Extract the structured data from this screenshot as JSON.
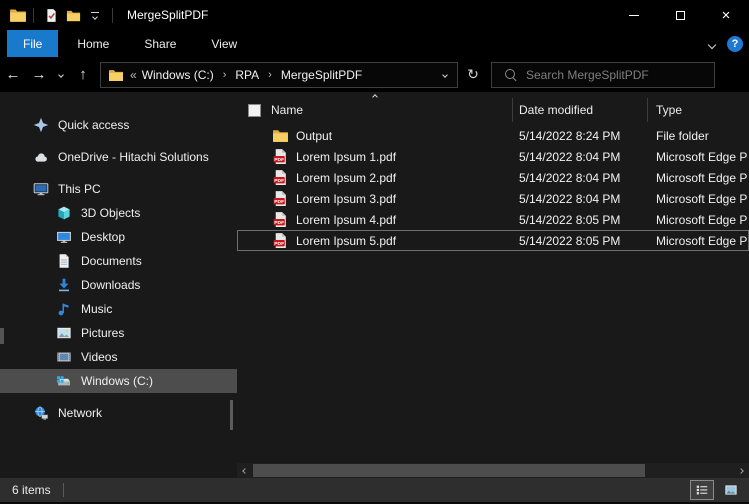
{
  "window": {
    "title": "MergeSplitPDF"
  },
  "ribbon": {
    "tabs": [
      {
        "label": "File",
        "active": true
      },
      {
        "label": "Home",
        "active": false
      },
      {
        "label": "Share",
        "active": false
      },
      {
        "label": "View",
        "active": false
      }
    ],
    "help_label": "?"
  },
  "address_bar": {
    "overflow_prefix": "«",
    "separator": "›",
    "segments": [
      "Windows (C:)",
      "RPA",
      "MergeSplitPDF"
    ]
  },
  "search": {
    "placeholder": "Search MergeSplitPDF"
  },
  "sidebar": {
    "items": [
      {
        "label": "Quick access",
        "icon": "quick-access-star-icon",
        "level": 0,
        "selected": false
      },
      {
        "label": "OneDrive - Hitachi Solutions",
        "icon": "onedrive-cloud-icon",
        "level": 0,
        "selected": false
      },
      {
        "label": "This PC",
        "icon": "this-pc-icon",
        "level": 0,
        "selected": false
      },
      {
        "label": "3D Objects",
        "icon": "3d-objects-icon",
        "level": 1,
        "selected": false
      },
      {
        "label": "Desktop",
        "icon": "desktop-icon",
        "level": 1,
        "selected": false
      },
      {
        "label": "Documents",
        "icon": "documents-icon",
        "level": 1,
        "selected": false
      },
      {
        "label": "Downloads",
        "icon": "downloads-icon",
        "level": 1,
        "selected": false
      },
      {
        "label": "Music",
        "icon": "music-icon",
        "level": 1,
        "selected": false
      },
      {
        "label": "Pictures",
        "icon": "pictures-icon",
        "level": 1,
        "selected": false
      },
      {
        "label": "Videos",
        "icon": "videos-icon",
        "level": 1,
        "selected": false
      },
      {
        "label": "Windows (C:)",
        "icon": "windows-drive-icon",
        "level": 1,
        "selected": true
      },
      {
        "label": "Network",
        "icon": "network-icon",
        "level": 0,
        "selected": false
      }
    ]
  },
  "file_list": {
    "columns": [
      {
        "label": "Name",
        "sort": "ascending"
      },
      {
        "label": "Date modified",
        "sort": null
      },
      {
        "label": "Type",
        "sort": null
      }
    ],
    "rows": [
      {
        "name": "Output",
        "icon": "folder-icon",
        "date_modified": "5/14/2022 8:24 PM",
        "type": "File folder",
        "focused": false
      },
      {
        "name": "Lorem Ipsum 1.pdf",
        "icon": "pdf-icon",
        "date_modified": "5/14/2022 8:04 PM",
        "type": "Microsoft Edge P",
        "focused": false
      },
      {
        "name": "Lorem Ipsum 2.pdf",
        "icon": "pdf-icon",
        "date_modified": "5/14/2022 8:04 PM",
        "type": "Microsoft Edge P",
        "focused": false
      },
      {
        "name": "Lorem Ipsum 3.pdf",
        "icon": "pdf-icon",
        "date_modified": "5/14/2022 8:04 PM",
        "type": "Microsoft Edge P",
        "focused": false
      },
      {
        "name": "Lorem Ipsum 4.pdf",
        "icon": "pdf-icon",
        "date_modified": "5/14/2022 8:05 PM",
        "type": "Microsoft Edge P",
        "focused": false
      },
      {
        "name": "Lorem Ipsum 5.pdf",
        "icon": "pdf-icon",
        "date_modified": "5/14/2022 8:05 PM",
        "type": "Microsoft Edge P",
        "focused": true
      }
    ]
  },
  "status_bar": {
    "items_count": "6 items"
  },
  "icons": {
    "search-icon": "magnifier",
    "refresh-icon": "↻",
    "back-icon": "←",
    "forward-icon": "→",
    "up-icon": "↑",
    "recent-locations-icon": "chevron-down",
    "ribbon-expand-icon": "chevron-down",
    "pdf-icon": "page with red PDF badge",
    "folder-icon": "yellow folder",
    "minimize-icon": "horizontal bar",
    "maximize-icon": "square outline",
    "close-icon": "×"
  },
  "colors": {
    "accent_blue": "#1979ca",
    "titlebar_bg": "#000000",
    "content_bg": "#191919",
    "sidebar_selection": "#4d4d4d",
    "statusbar_bg": "#2e2e2e",
    "pdf_red": "#c8161d",
    "folder_yellow": "#f6cf65",
    "help_circle_blue": "#1f78d1"
  }
}
